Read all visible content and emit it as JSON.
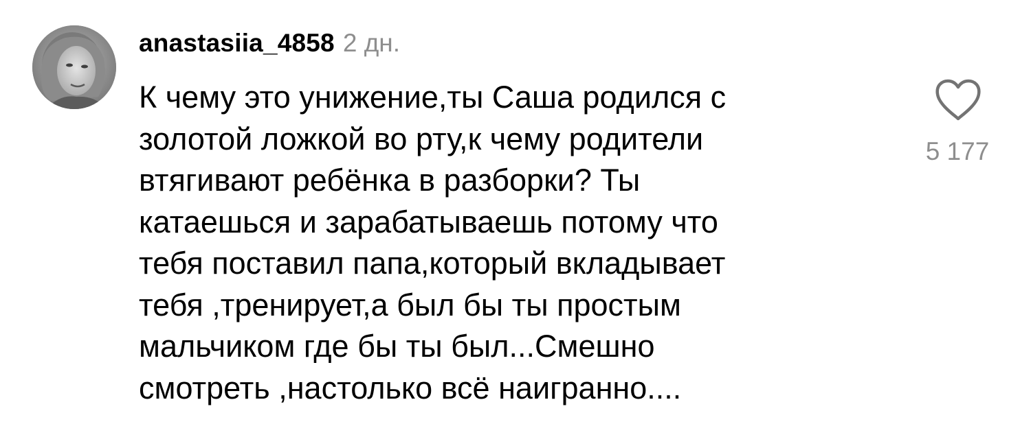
{
  "comment": {
    "avatar_icon": "user-avatar-photo",
    "username": "anastasiia_4858",
    "timestamp": "2 дн.",
    "text_lines": [
      "К чему это унижение,ты Саша родился с",
      "золотой ложкой во рту,к чему родители",
      "втягивают ребёнка в разборки? Ты",
      "катаешься и зарабатываешь потому что",
      "тебя поставил папа,который вкладывает",
      "тебя ,тренирует,а был бы ты простым",
      "мальчиком где бы ты был...Смешно",
      "смотреть ,настолько всё наигранно...."
    ],
    "like_icon": "heart-outline-icon",
    "like_count": "5 177"
  },
  "colors": {
    "text": "#000000",
    "secondary_text": "#8e8e8e",
    "background": "#ffffff",
    "icon": "#737373"
  }
}
